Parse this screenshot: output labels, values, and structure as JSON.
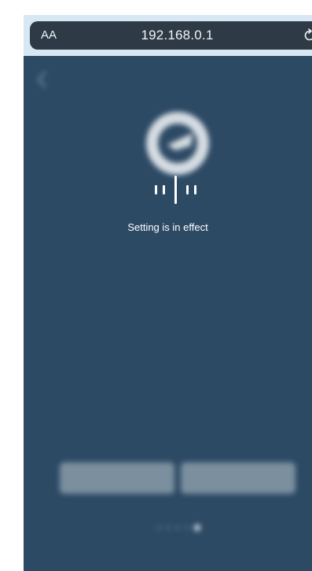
{
  "browser": {
    "text_size_button": "AA",
    "url": "192.168.0.1"
  },
  "loading": {
    "message": "Setting is in effect"
  },
  "colors": {
    "background": "#2d4a65",
    "address_bar": "#2e3a45",
    "overlay_text": "#ffffff"
  },
  "pager": {
    "count": 5,
    "active_index": 4
  }
}
